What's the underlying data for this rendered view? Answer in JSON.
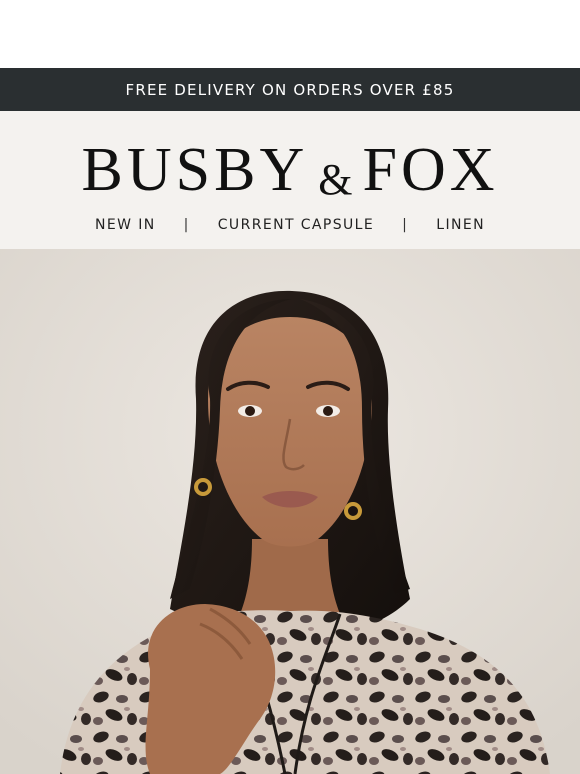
{
  "promo": {
    "text": "FREE DELIVERY ON ORDERS OVER £85"
  },
  "brand": {
    "name_left": "BUSBY",
    "ampersand": "&",
    "name_right": "FOX"
  },
  "nav": {
    "items": [
      {
        "label": "NEW IN"
      },
      {
        "label": "CURRENT CAPSULE"
      },
      {
        "label": "LINEN"
      }
    ],
    "separator": "|"
  },
  "colors": {
    "promo_bg": "#2a2f31",
    "header_bg": "#f4f2ef",
    "text_dark": "#111111"
  },
  "hero": {
    "image_icon": "model-photo-icon"
  }
}
